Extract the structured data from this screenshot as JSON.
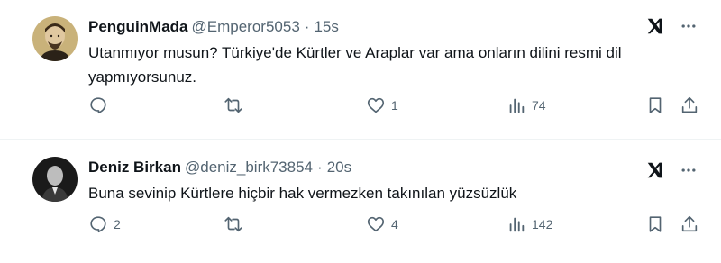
{
  "tweets": [
    {
      "name": "PenguinMada",
      "handle": "@Emperor5053",
      "separator": "·",
      "time": "15s",
      "text": "Utanmıyor musun? Türkiye'de Kürtler ve Araplar var ama onların dilini resmi dil yapmıyorsunuz.",
      "replies": "",
      "retweets": "",
      "likes": "1",
      "views": "74",
      "avatar_icon": "portrait-avatar"
    },
    {
      "name": "Deniz Birkan",
      "handle": "@deniz_birk73854",
      "separator": "·",
      "time": "20s",
      "text": "Buna sevinip Kürtlere hiçbir hak vermezken takınılan yüzsüzlük",
      "replies": "2",
      "retweets": "",
      "likes": "4",
      "views": "142",
      "avatar_icon": "photo-avatar"
    }
  ],
  "colors": {
    "text": "#0f1419",
    "secondary": "#536471",
    "divider": "#eff3f4"
  },
  "icons": [
    "grok-icon",
    "more-icon",
    "reply-icon",
    "retweet-icon",
    "like-icon",
    "views-icon",
    "bookmark-icon",
    "share-icon"
  ]
}
